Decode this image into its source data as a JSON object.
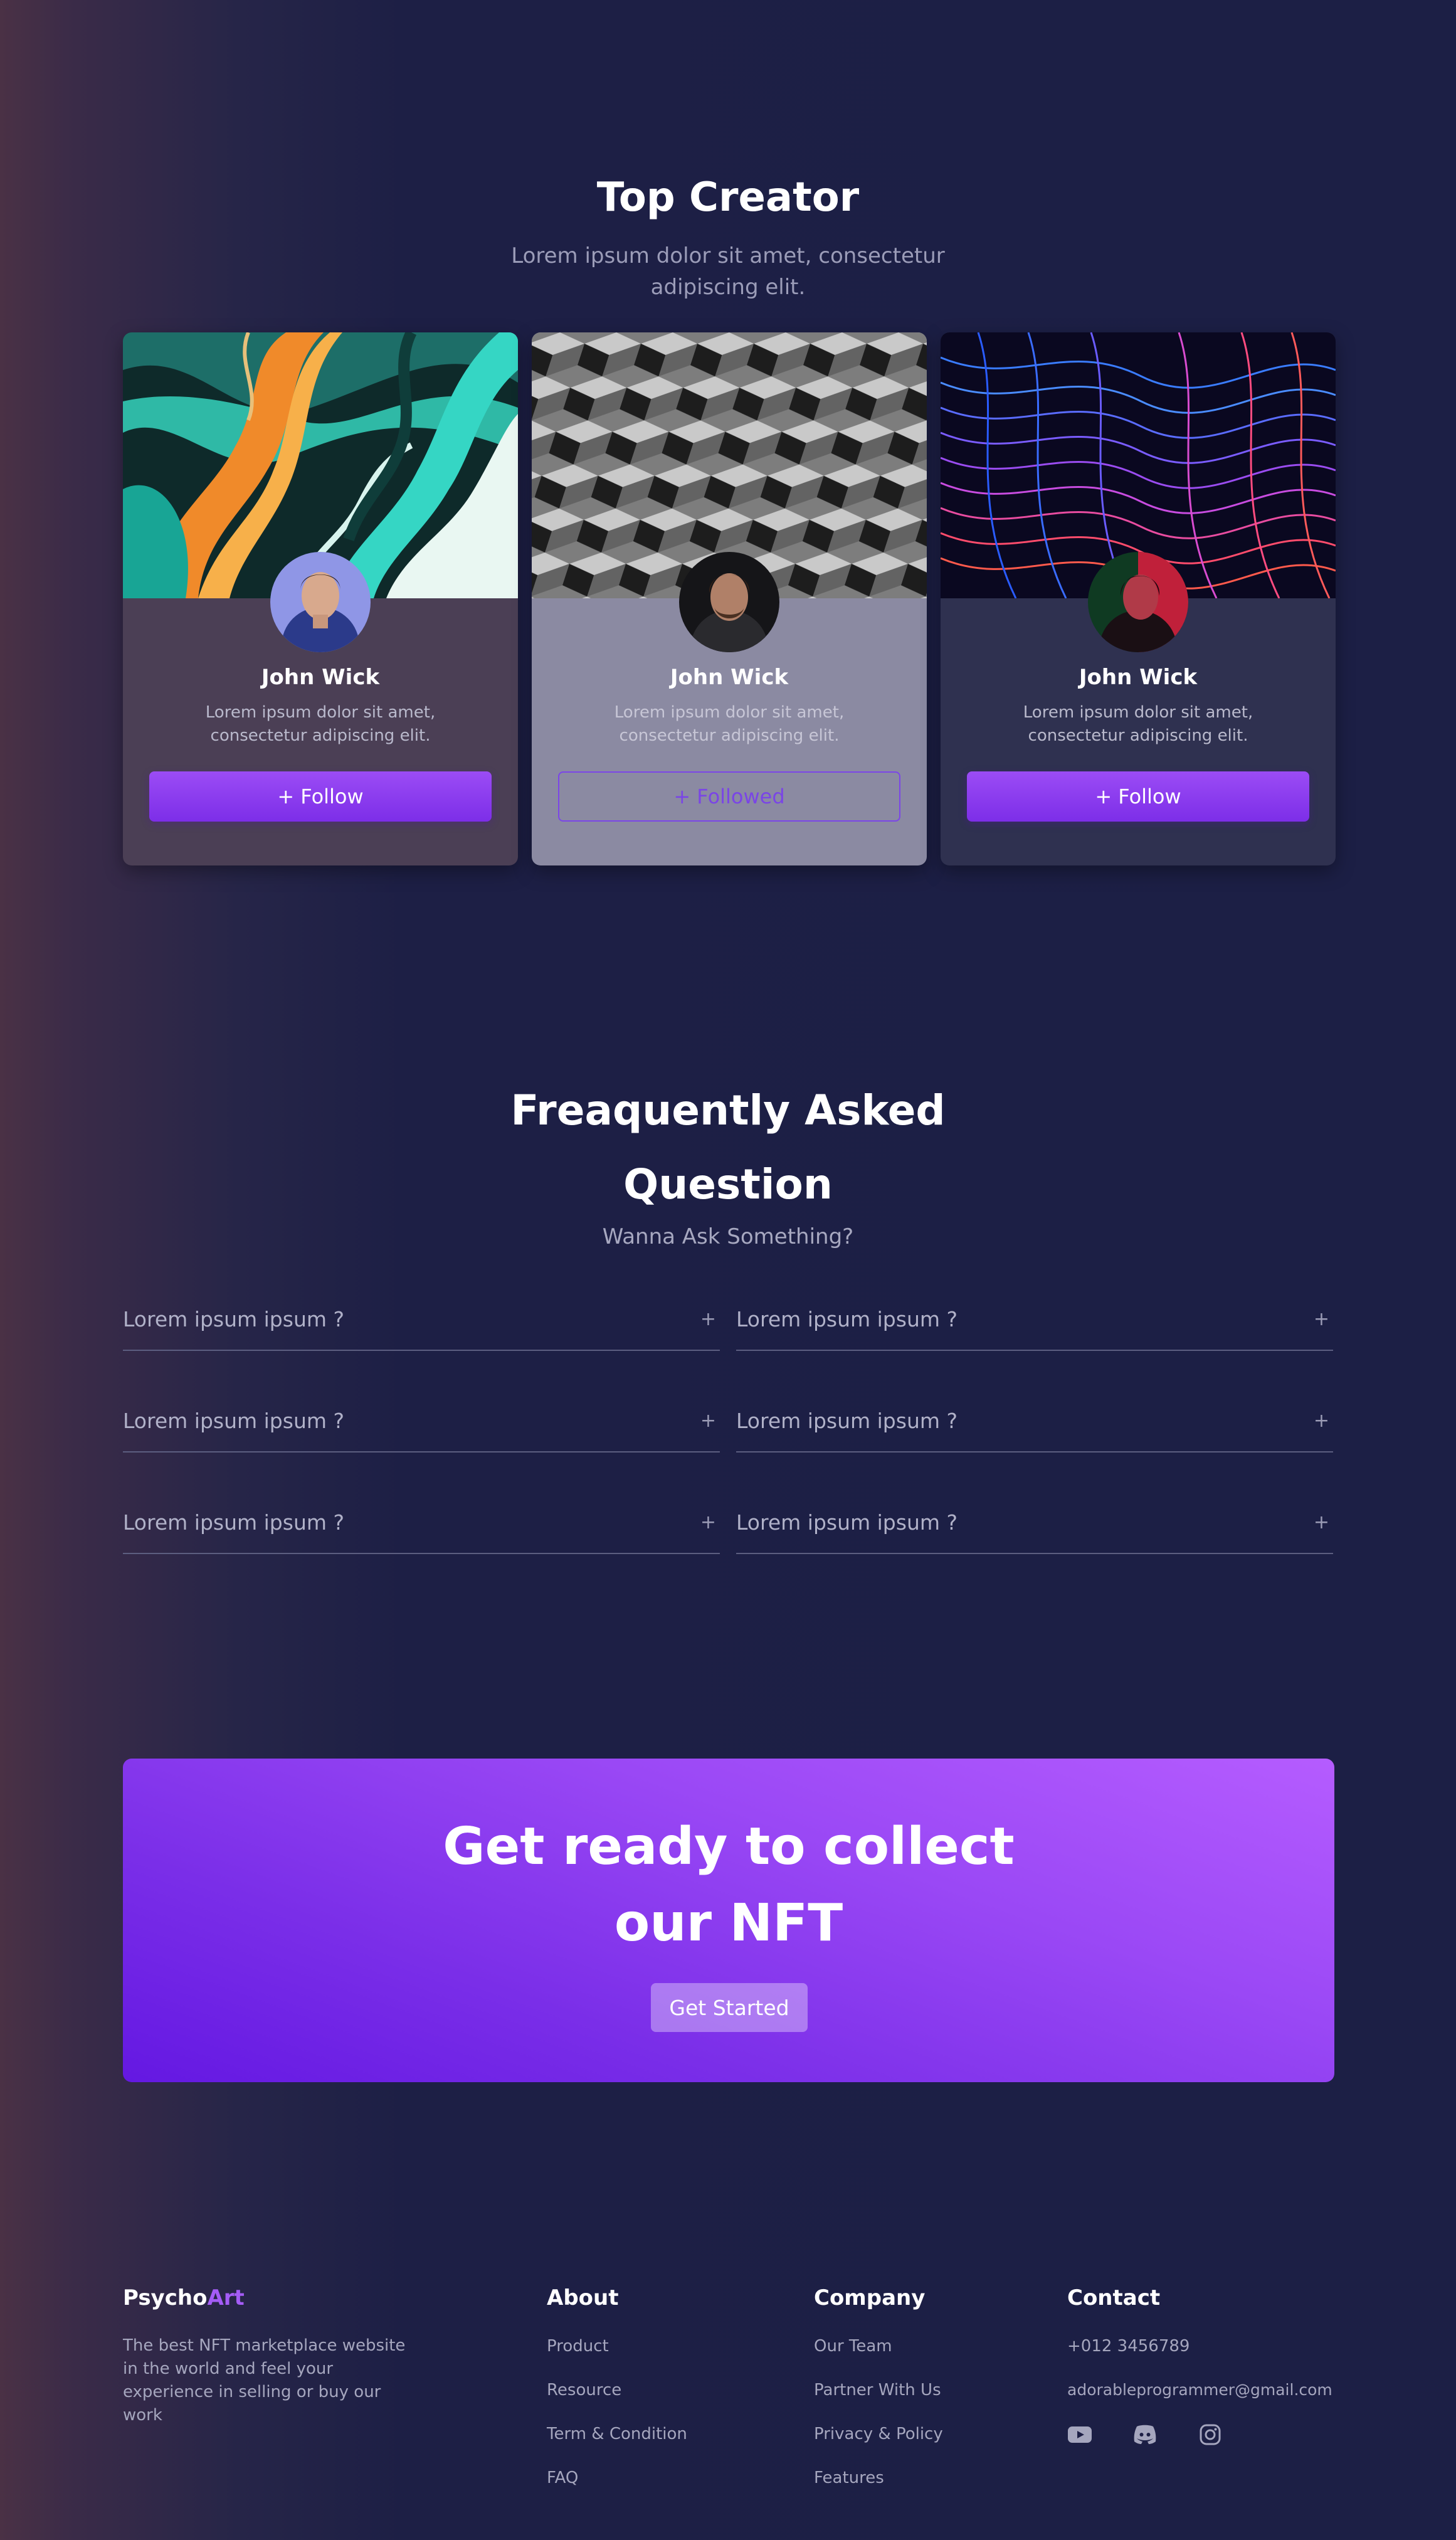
{
  "creators": {
    "title": "Top Creator",
    "subtitle": "Lorem ipsum dolor sit amet, consectetur adipiscing elit.",
    "cards": [
      {
        "name": "John Wick",
        "description": "Lorem ipsum dolor sit amet, consectetur adipiscing elit.",
        "button": "+ Follow",
        "state": "follow",
        "bg": "#4b3f55"
      },
      {
        "name": "John Wick",
        "description": "Lorem ipsum dolor sit amet, consectetur adipiscing elit.",
        "button": "+ Followed",
        "state": "followed",
        "bg": "#8b8aa2"
      },
      {
        "name": "John Wick",
        "description": "Lorem ipsum dolor sit amet, consectetur adipiscing elit.",
        "button": "+ Follow",
        "state": "follow",
        "bg": "#2f3150"
      }
    ]
  },
  "faq": {
    "title_line1": "Freaquently Asked",
    "title_line2": "Question",
    "subtitle": "Wanna Ask Something?",
    "items": [
      {
        "question": "Lorem ipsum ipsum ?",
        "icon": "+"
      },
      {
        "question": "Lorem ipsum ipsum ?",
        "icon": "+"
      },
      {
        "question": "Lorem ipsum ipsum ?",
        "icon": "+"
      },
      {
        "question": "Lorem ipsum ipsum ?",
        "icon": "+"
      },
      {
        "question": "Lorem ipsum ipsum ?",
        "icon": "+"
      },
      {
        "question": "Lorem ipsum ipsum ?",
        "icon": "+"
      }
    ]
  },
  "cta": {
    "title_line1": "Get ready to collect",
    "title_line2": "our NFT",
    "button": "Get Started"
  },
  "footer": {
    "brand_part1": "Psycho",
    "brand_part2": "Art",
    "brand_accent_color": "#a45cf6",
    "description": "The best NFT marketplace website in the world and feel your experience in selling or buy our work",
    "about": {
      "heading": "About",
      "links": [
        "Product",
        "Resource",
        "Term & Condition",
        "FAQ"
      ]
    },
    "company": {
      "heading": "Company",
      "links": [
        "Our Team",
        "Partner With Us",
        "Privacy & Policy",
        "Features"
      ]
    },
    "contact": {
      "heading": "Contact",
      "phone": "+012 3456789",
      "email": "adorableprogrammer@gmail.com",
      "social_icons": [
        "youtube-icon",
        "discord-icon",
        "instagram-icon"
      ]
    }
  },
  "colors": {
    "accent": "#8b3ff0",
    "background": "#1d1f45",
    "muted_text": "#a5a6be"
  }
}
